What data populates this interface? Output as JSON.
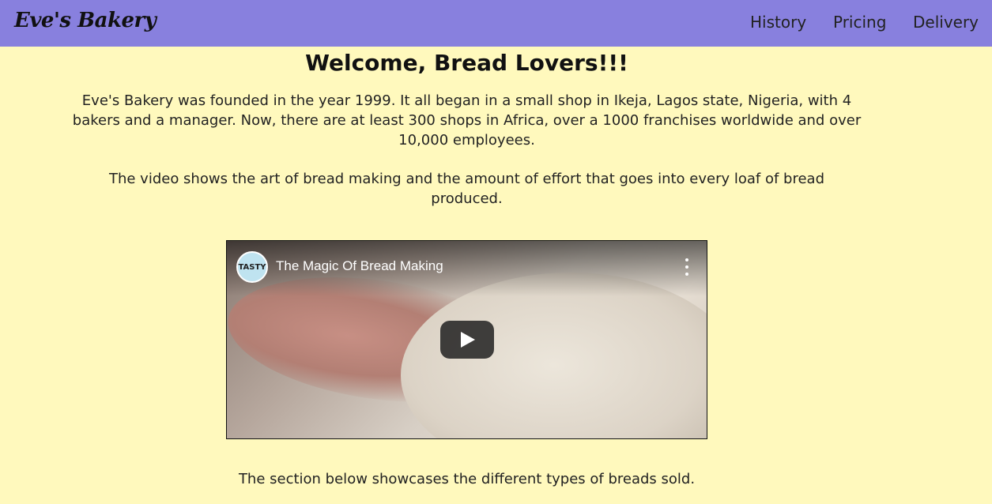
{
  "header": {
    "logo": "Eve's Bakery",
    "nav": [
      "History",
      "Pricing",
      "Delivery"
    ]
  },
  "main": {
    "heading": "Welcome, Bread Lovers!!!",
    "intro": "Eve's Bakery was founded in the year 1999. It all began in a small shop in Ikeja, Lagos state, Nigeria, with 4 bakers and a manager. Now, there are at least 300 shops in Africa, over a 1000 franchises worldwide and over 10,000 employees.",
    "video_text": "The video shows the art of bread making and the amount of effort that goes into every loaf of bread produced.",
    "section_text": "The section below showcases the different types of breads sold."
  },
  "video": {
    "title": "The Magic Of Bread Making",
    "channel": "TASTY",
    "icons": [
      "channel-avatar-icon",
      "more-options-icon",
      "play-icon"
    ]
  },
  "colors": {
    "navbar": "#8880de",
    "background": "#fff9bd"
  }
}
